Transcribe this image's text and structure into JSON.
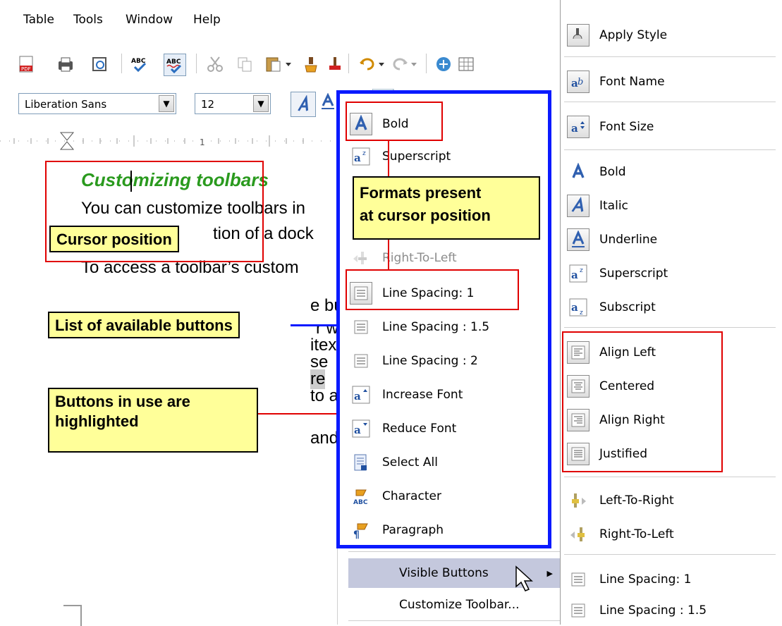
{
  "menubar": {
    "items": [
      "Table",
      "Tools",
      "Window",
      "Help"
    ]
  },
  "toolbar": {
    "font_name": "Liberation Sans",
    "font_size": "12"
  },
  "document": {
    "heading": "Customizing toolbars",
    "lines": [
      "You can customize toolbars in",
      "tion of a dock",
      "To access a toolbar’s custom",
      "e bu",
      "r w",
      "itex",
      "se",
      "re",
      "to a",
      "and"
    ]
  },
  "callouts": {
    "cursor_position": "Cursor position",
    "available_buttons": "List of available buttons",
    "in_use_line1": "Buttons in use are",
    "in_use_line2": "highlighted",
    "formats_line1": "Formats present",
    "formats_line2": "at cursor position"
  },
  "menu_left": {
    "items": [
      {
        "label": "Bold",
        "icon": "bold-icon",
        "framed": true
      },
      {
        "label": "Superscript",
        "icon": "superscript-icon",
        "framed": false
      },
      {
        "label": "Right-To-Left",
        "icon": "right-to-left-icon",
        "framed": false,
        "disabled": true
      },
      {
        "label": "Line Spacing: 1",
        "icon": "line-spacing-icon",
        "framed": true
      },
      {
        "label": "Line Spacing : 1.5",
        "icon": "line-spacing-icon",
        "framed": false
      },
      {
        "label": "Line Spacing : 2",
        "icon": "line-spacing-icon",
        "framed": false
      },
      {
        "label": "Increase Font",
        "icon": "increase-font-icon",
        "framed": false
      },
      {
        "label": "Reduce Font",
        "icon": "reduce-font-icon",
        "framed": false
      },
      {
        "label": "Select All",
        "icon": "select-all-icon",
        "framed": false
      },
      {
        "label": "Character",
        "icon": "character-icon",
        "framed": false
      },
      {
        "label": "Paragraph",
        "icon": "paragraph-icon",
        "framed": false
      }
    ],
    "visible_buttons": "Visible Buttons",
    "customize_toolbar": "Customize Toolbar..."
  },
  "menu_right": {
    "items": [
      {
        "label": "Apply Style",
        "icon": "apply-style-icon"
      },
      {
        "label": "Font Name",
        "icon": "font-name-icon"
      },
      {
        "label": "Font Size",
        "icon": "font-size-icon"
      },
      {
        "label": "Bold",
        "icon": "bold-icon"
      },
      {
        "label": "Italic",
        "icon": "italic-icon"
      },
      {
        "label": "Underline",
        "icon": "underline-icon"
      },
      {
        "label": "Superscript",
        "icon": "superscript-icon"
      },
      {
        "label": "Subscript",
        "icon": "subscript-icon"
      },
      {
        "label": "Align Left",
        "icon": "align-left-icon"
      },
      {
        "label": "Centered",
        "icon": "align-center-icon"
      },
      {
        "label": "Align Right",
        "icon": "align-right-icon"
      },
      {
        "label": "Justified",
        "icon": "justify-icon"
      },
      {
        "label": "Left-To-Right",
        "icon": "left-to-right-icon"
      },
      {
        "label": "Right-To-Left",
        "icon": "right-to-left-icon"
      },
      {
        "label": "Line Spacing: 1",
        "icon": "line-spacing-icon"
      },
      {
        "label": "Line Spacing : 1.5",
        "icon": "line-spacing-icon"
      }
    ]
  },
  "colors": {
    "heading_green": "#2a9a1e",
    "callout_yellow": "#ffff99",
    "annotation_red": "#e00000",
    "annotation_blue": "#0a1aff",
    "menu_highlight": "#c4c8dd"
  }
}
